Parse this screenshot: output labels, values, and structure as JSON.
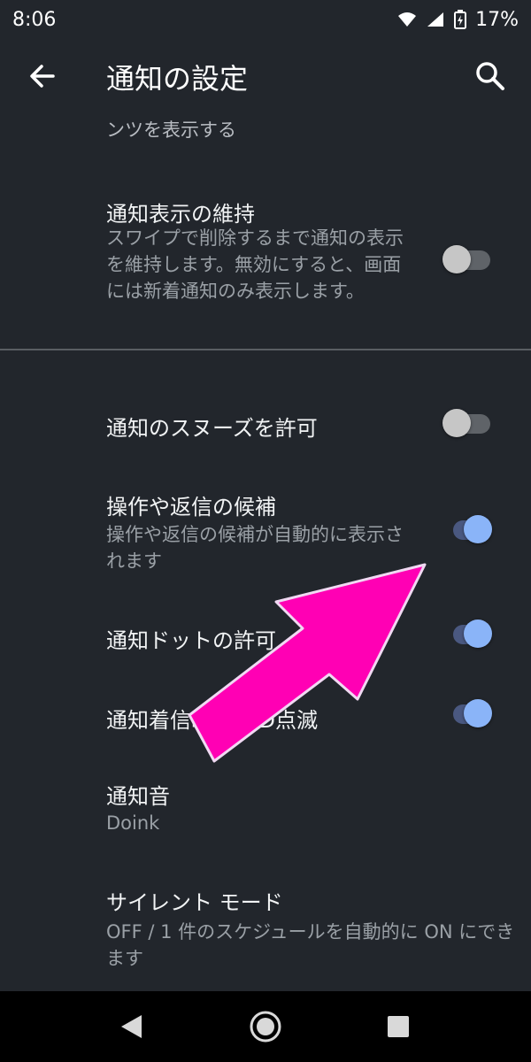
{
  "status_bar": {
    "time": "8:06",
    "battery": "17%"
  },
  "app_bar": {
    "title": "通知の設定"
  },
  "items": {
    "partial": {
      "text": "ンツを表示する"
    },
    "keep": {
      "title": "通知表示の維持",
      "summary": "スワイプで削除するまで通知の表示を維持します。無効にすると、画面には新着通知のみ表示します。",
      "checked": false
    },
    "snooze": {
      "title": "通知のスヌーズを許可",
      "checked": false
    },
    "suggest": {
      "title": "操作や返信の候補",
      "summary": "操作や返信の候補が自動的に表示されます",
      "checked": true
    },
    "dot": {
      "title": "通知ドットの許可",
      "checked": true
    },
    "blink": {
      "title": "通知着信時のLED点滅",
      "checked": true
    },
    "sound": {
      "title": "通知音",
      "summary": "Doink"
    },
    "silent": {
      "title": "サイレント モード",
      "summary": "OFF / 1 件のスケジュールを自動的に ON にできます"
    }
  },
  "colors": {
    "accent": "#8ab4f8",
    "arrow": "#ff00b4",
    "background": "#22262c"
  }
}
